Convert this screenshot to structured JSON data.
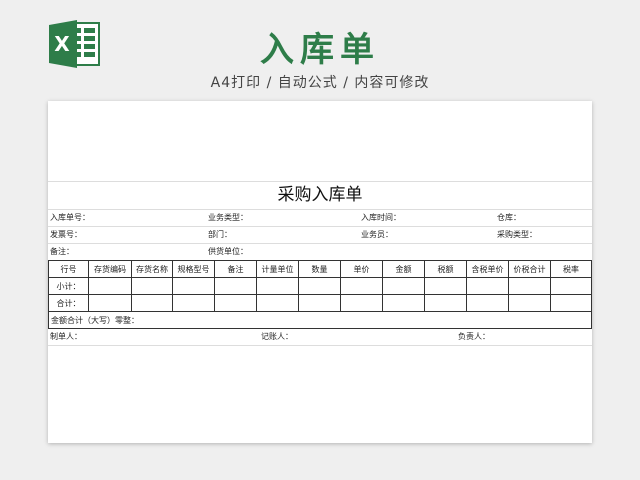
{
  "header": {
    "title": "入库单",
    "subtitle": "A4打印 / 自动公式 / 内容可修改",
    "logo_letter": "X",
    "brand_color": "#2e7d49"
  },
  "document": {
    "title": "采购入库单",
    "info_rows": [
      [
        "入库单号：",
        "业务类型：",
        "入库时间：",
        "仓库："
      ],
      [
        "发票号：",
        "部门：",
        "业务员：",
        "采购类型："
      ],
      [
        "备注：",
        "供货单位："
      ]
    ],
    "columns": [
      "行号",
      "存货编码",
      "存货名称",
      "规格型号",
      "备注",
      "计量单位",
      "数量",
      "单价",
      "金额",
      "税额",
      "含税单价",
      "价税合计",
      "税率"
    ],
    "row_labels": [
      "小计：",
      "合计："
    ],
    "amount_row": "金额合计（大写）零整：",
    "signatures": [
      "制单人：",
      "记账人：",
      "负责人："
    ]
  }
}
